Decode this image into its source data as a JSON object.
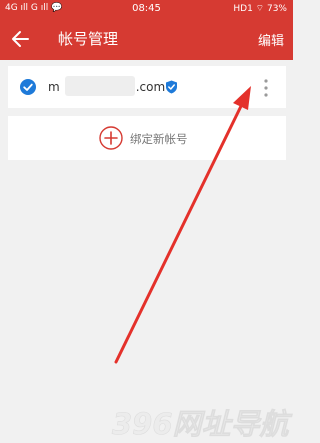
{
  "status_bar": {
    "left": "4G ıll G ıll 💬",
    "time": "08:45",
    "right": "HD1 ⌔ 73%"
  },
  "header": {
    "title": "帐号管理",
    "edit_label": "编辑"
  },
  "account": {
    "email_start": "m",
    "email_end": ".com"
  },
  "add_account": {
    "label": "绑定新帐号"
  },
  "watermark": {
    "text": "396网址导航"
  },
  "colors": {
    "brand": "#d63a32",
    "check": "#1e7ad9",
    "background": "#f1f1f1"
  },
  "icons": [
    "back-icon",
    "check-icon",
    "verified-icon",
    "more-icon",
    "add-circle-icon",
    "annotation-arrow"
  ]
}
